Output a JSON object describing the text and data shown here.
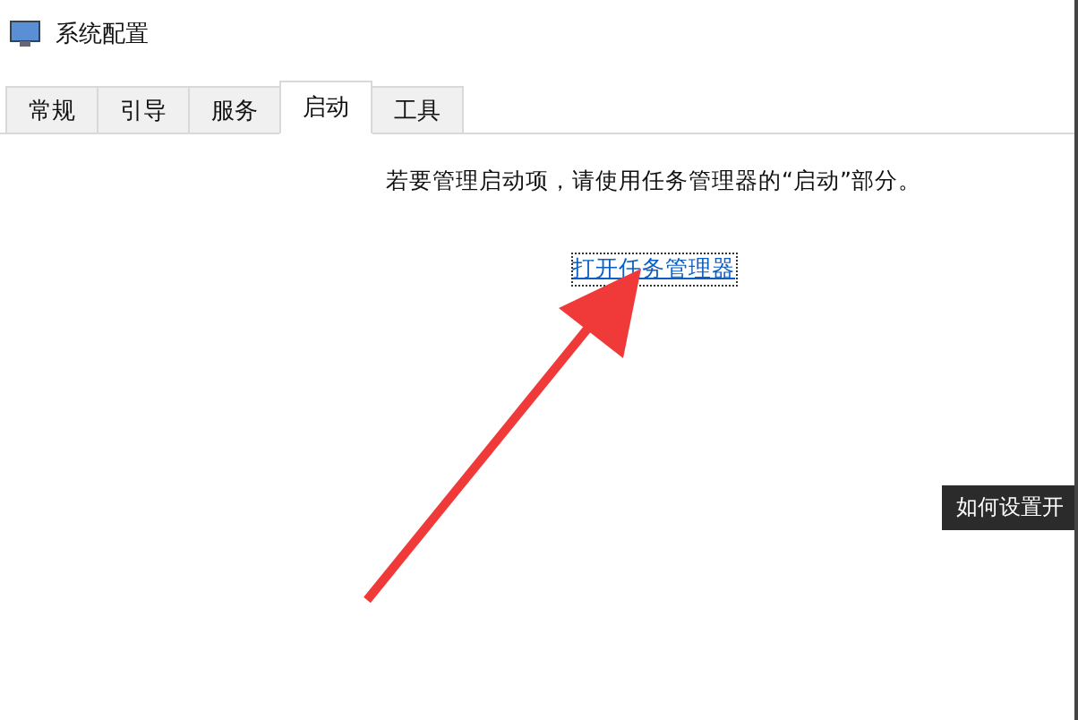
{
  "window": {
    "title": "系统配置"
  },
  "tabs": [
    {
      "label": "常规",
      "selected": false
    },
    {
      "label": "引导",
      "selected": false
    },
    {
      "label": "服务",
      "selected": false
    },
    {
      "label": "启动",
      "selected": true
    },
    {
      "label": "工具",
      "selected": false
    }
  ],
  "startup": {
    "message": "若要管理启动项，请使用任务管理器的“启动”部分。",
    "link": "打开任务管理器"
  },
  "tooltip": {
    "text": "如何设置开"
  }
}
